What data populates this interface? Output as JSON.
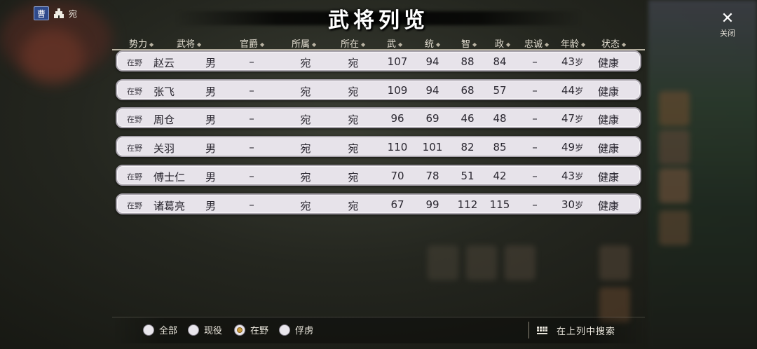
{
  "faction": {
    "badge": "曹",
    "city": "宛"
  },
  "title": "武将列览",
  "close": {
    "label": "关闭"
  },
  "columns": [
    {
      "key": "force",
      "label": "势力"
    },
    {
      "key": "name",
      "label": "武将"
    },
    {
      "key": "rank",
      "label": "官爵"
    },
    {
      "key": "belong",
      "label": "所属"
    },
    {
      "key": "location",
      "label": "所在"
    },
    {
      "key": "war",
      "label": "武"
    },
    {
      "key": "lead",
      "label": "统"
    },
    {
      "key": "intel",
      "label": "智"
    },
    {
      "key": "pol",
      "label": "政"
    },
    {
      "key": "loyalty",
      "label": "忠诚"
    },
    {
      "key": "age",
      "label": "年龄"
    },
    {
      "key": "state",
      "label": "状态"
    }
  ],
  "officers": [
    {
      "status": "在野",
      "name": "赵云",
      "gender": "男",
      "rank": "–",
      "belong": "宛",
      "location": "宛",
      "war": "107",
      "lead": "94",
      "intel": "88",
      "pol": "84",
      "loyalty": "–",
      "age": "43",
      "age_unit": "岁",
      "state": "健康"
    },
    {
      "status": "在野",
      "name": "张飞",
      "gender": "男",
      "rank": "–",
      "belong": "宛",
      "location": "宛",
      "war": "109",
      "lead": "94",
      "intel": "68",
      "pol": "57",
      "loyalty": "–",
      "age": "44",
      "age_unit": "岁",
      "state": "健康"
    },
    {
      "status": "在野",
      "name": "周仓",
      "gender": "男",
      "rank": "–",
      "belong": "宛",
      "location": "宛",
      "war": "96",
      "lead": "69",
      "intel": "46",
      "pol": "48",
      "loyalty": "–",
      "age": "47",
      "age_unit": "岁",
      "state": "健康"
    },
    {
      "status": "在野",
      "name": "关羽",
      "gender": "男",
      "rank": "–",
      "belong": "宛",
      "location": "宛",
      "war": "110",
      "lead": "101",
      "intel": "82",
      "pol": "85",
      "loyalty": "–",
      "age": "49",
      "age_unit": "岁",
      "state": "健康"
    },
    {
      "status": "在野",
      "name": "傅士仁",
      "gender": "男",
      "rank": "–",
      "belong": "宛",
      "location": "宛",
      "war": "70",
      "lead": "78",
      "intel": "51",
      "pol": "42",
      "loyalty": "–",
      "age": "43",
      "age_unit": "岁",
      "state": "健康"
    },
    {
      "status": "在野",
      "name": "诸葛亮",
      "gender": "男",
      "rank": "–",
      "belong": "宛",
      "location": "宛",
      "war": "67",
      "lead": "99",
      "intel": "112",
      "pol": "115",
      "loyalty": "–",
      "age": "30",
      "age_unit": "岁",
      "state": "健康"
    }
  ],
  "filters": [
    {
      "label": "全部",
      "selected": false
    },
    {
      "label": "现役",
      "selected": false
    },
    {
      "label": "在野",
      "selected": true
    },
    {
      "label": "俘虏",
      "selected": false
    }
  ],
  "search": {
    "label": "在上列中搜索"
  },
  "colors": {
    "row_bg": "#e7e3ea",
    "radio_selected": "#c89a3a",
    "faction_badge": "#2f4a8c"
  }
}
